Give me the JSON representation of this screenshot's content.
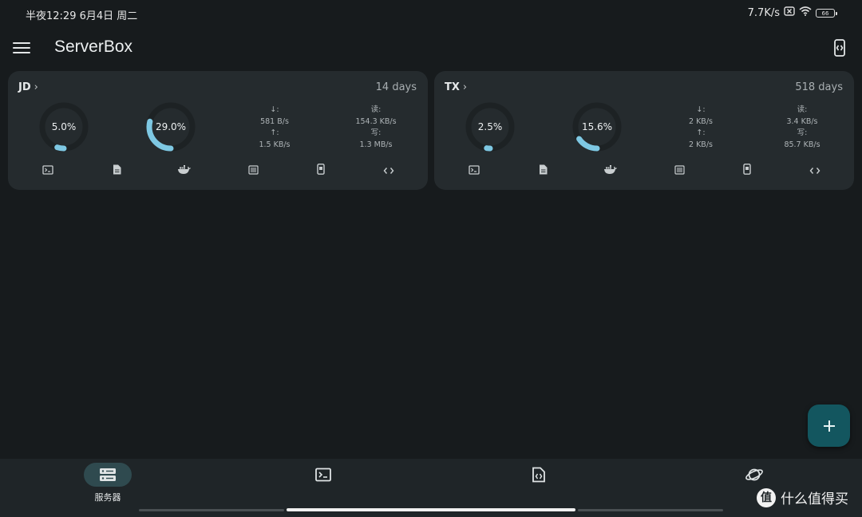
{
  "status_bar": {
    "time_date": "半夜12:29 6月4日 周二",
    "net_speed": "7.7K/s",
    "battery": "66"
  },
  "app": {
    "title": "ServerBox"
  },
  "servers": [
    {
      "name": "JD",
      "uptime": "14 days",
      "cpu": {
        "label": "5.0%",
        "fraction": 0.05
      },
      "mem": {
        "label": "29.0%",
        "fraction": 0.29
      },
      "net": {
        "down_label": "↓:",
        "down": "581 B/s",
        "up_label": "↑:",
        "up": "1.5 KB/s"
      },
      "disk": {
        "read_label": "读:",
        "read": "154.3 KB/s",
        "write_label": "写:",
        "write": "1.3 MB/s"
      }
    },
    {
      "name": "TX",
      "uptime": "518 days",
      "cpu": {
        "label": "2.5%",
        "fraction": 0.025
      },
      "mem": {
        "label": "15.6%",
        "fraction": 0.156
      },
      "net": {
        "down_label": "↓:",
        "down": "2 KB/s",
        "up_label": "↑:",
        "up": "2 KB/s"
      },
      "disk": {
        "read_label": "读:",
        "read": "3.4 KB/s",
        "write_label": "写:",
        "write": "85.7 KB/s"
      }
    }
  ],
  "card_actions": [
    "terminal-icon",
    "file-icon",
    "docker-icon",
    "process-list-icon",
    "device-icon",
    "code-icon"
  ],
  "bottom_nav": {
    "items": [
      {
        "label": "服务器",
        "icon": "server-icon",
        "active": true
      },
      {
        "label": "",
        "icon": "terminal-icon",
        "active": false
      },
      {
        "label": "",
        "icon": "code-file-icon",
        "active": false
      },
      {
        "label": "",
        "icon": "planet-icon",
        "active": false
      }
    ]
  },
  "watermark": {
    "text": "什么值得买",
    "logo": "值"
  },
  "colors": {
    "background": "#171b1d",
    "card": "#252b2e",
    "gauge_track": "#1d2224",
    "gauge_fill": "#7ec8e3",
    "fab": "#13565f",
    "nav_active": "#2f4a4f"
  }
}
